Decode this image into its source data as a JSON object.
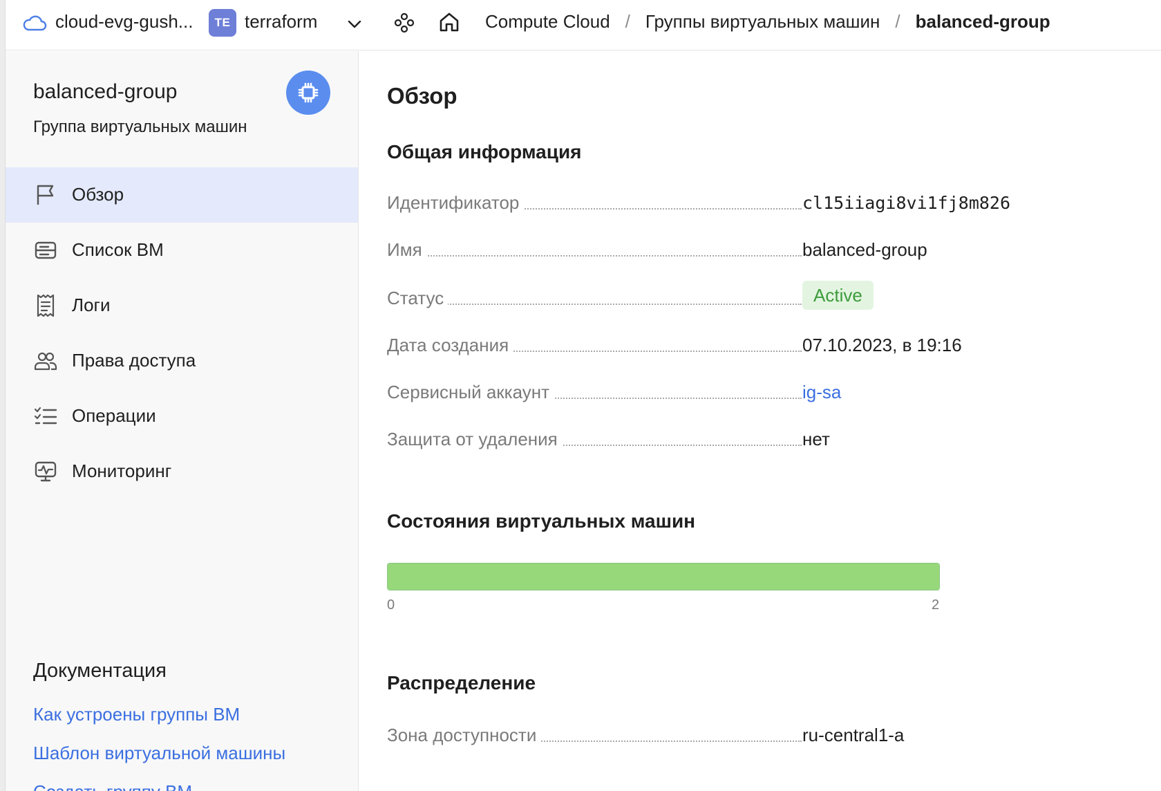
{
  "header": {
    "cloud_name": "cloud-evg-gush...",
    "folder_badge": "TE",
    "folder_name": "terraform",
    "breadcrumbs": [
      "Compute Cloud",
      "Группы виртуальных машин",
      "balanced-group"
    ],
    "separator": "/"
  },
  "sidebar": {
    "title": "balanced-group",
    "subtitle": "Группа виртуальных машин",
    "nav": [
      {
        "label": "Обзор",
        "icon": "flag-icon",
        "active": true
      },
      {
        "label": "Список ВМ",
        "icon": "server-list-icon",
        "active": false
      },
      {
        "label": "Логи",
        "icon": "receipt-icon",
        "active": false
      },
      {
        "label": "Права доступа",
        "icon": "users-icon",
        "active": false
      },
      {
        "label": "Операции",
        "icon": "checklist-icon",
        "active": false
      },
      {
        "label": "Мониторинг",
        "icon": "monitor-chart-icon",
        "active": false
      }
    ],
    "docs_title": "Документация",
    "docs_links": [
      "Как устроены группы ВМ",
      "Шаблон виртуальной машины",
      "Создать группу ВМ"
    ]
  },
  "main": {
    "page_title": "Обзор",
    "general_title": "Общая информация",
    "fields": {
      "id_label": "Идентификатор",
      "id_value": "cl15iiagi8vi1fj8m826",
      "name_label": "Имя",
      "name_value": "balanced-group",
      "status_label": "Статус",
      "status_value": "Active",
      "created_label": "Дата создания",
      "created_value": "07.10.2023, в 19:16",
      "sa_label": "Сервисный аккаунт",
      "sa_value": "ig-sa",
      "protection_label": "Защита от удаления",
      "protection_value": "нет"
    },
    "vm_states_title": "Состояния виртуальных машин",
    "vm_states": {
      "min": "0",
      "max": "2",
      "running_fraction": 1.0
    },
    "distribution_title": "Распределение",
    "zone_label": "Зона доступности",
    "zone_value": "ru-central1-a"
  },
  "colors": {
    "accent": "#3b6fe0",
    "service_badge": "#5b8def",
    "status_green_bg": "#e3f5e1",
    "status_green_text": "#3e9b3c",
    "bar_fill": "#96d87a",
    "nav_active_bg": "#e4e9fb"
  }
}
